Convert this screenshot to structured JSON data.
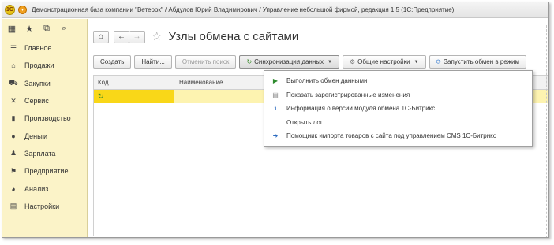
{
  "window": {
    "logo": "1С",
    "title": "Демонстрационная база компании \"Ветерок\" / Абдулов Юрий Владимирович / Управление небольшой фирмой, редакция 1.5 (1С:Предприятие)"
  },
  "sidebar": {
    "tools": [
      {
        "name": "apps-grid-icon",
        "glyph": "▦"
      },
      {
        "name": "favorites-star-icon",
        "glyph": "★"
      },
      {
        "name": "history-icon",
        "glyph": "⧉"
      },
      {
        "name": "search-icon",
        "glyph": "⌕"
      }
    ],
    "items": [
      {
        "label": "Главное",
        "icon": "menu-lines-icon",
        "glyph": "☰"
      },
      {
        "label": "Продажи",
        "icon": "sales-icon",
        "glyph": "⌂"
      },
      {
        "label": "Закупки",
        "icon": "purchases-icon",
        "glyph": "⛟"
      },
      {
        "label": "Сервис",
        "icon": "service-tools-icon",
        "glyph": "✕"
      },
      {
        "label": "Производство",
        "icon": "production-icon",
        "glyph": "▮"
      },
      {
        "label": "Деньги",
        "icon": "money-icon",
        "glyph": "●"
      },
      {
        "label": "Зарплата",
        "icon": "salary-people-icon",
        "glyph": "♟"
      },
      {
        "label": "Предприятие",
        "icon": "enterprise-flag-icon",
        "glyph": "⚑"
      },
      {
        "label": "Анализ",
        "icon": "analysis-chart-icon",
        "glyph": "◕"
      },
      {
        "label": "Настройки",
        "icon": "settings-icon",
        "glyph": "▤"
      }
    ]
  },
  "page": {
    "title": "Узлы обмена с сайтами"
  },
  "toolbar": {
    "create": "Создать",
    "find": "Найти...",
    "cancel_search": "Отменить поиск",
    "sync": "Синхронизация данных",
    "general_settings": "Общие настройки",
    "run_exchange": "Запустить обмен в режим"
  },
  "table": {
    "columns": [
      "Код",
      "Наименование"
    ]
  },
  "dropdown": {
    "items": [
      {
        "label": "Выполнить обмен данными",
        "icon": "play-icon",
        "glyph": "▶"
      },
      {
        "label": "Показать зарегистрированные изменения",
        "icon": "changes-list-icon",
        "glyph": "▤"
      },
      {
        "label": "Информация о версии модуля обмена 1С-Битрикс",
        "icon": "info-icon",
        "glyph": "ℹ"
      },
      {
        "label": "Открыть лог",
        "icon": "",
        "glyph": ""
      },
      {
        "label": "Помощник импорта товаров с сайта под управлением CMS 1С-Битрикс",
        "icon": "import-arrow-icon",
        "glyph": "➜"
      }
    ]
  },
  "colors": {
    "sidebar_bg": "#fbf3c8",
    "selected_cell": "#f9d718",
    "selected_row": "#fdf3b0"
  }
}
